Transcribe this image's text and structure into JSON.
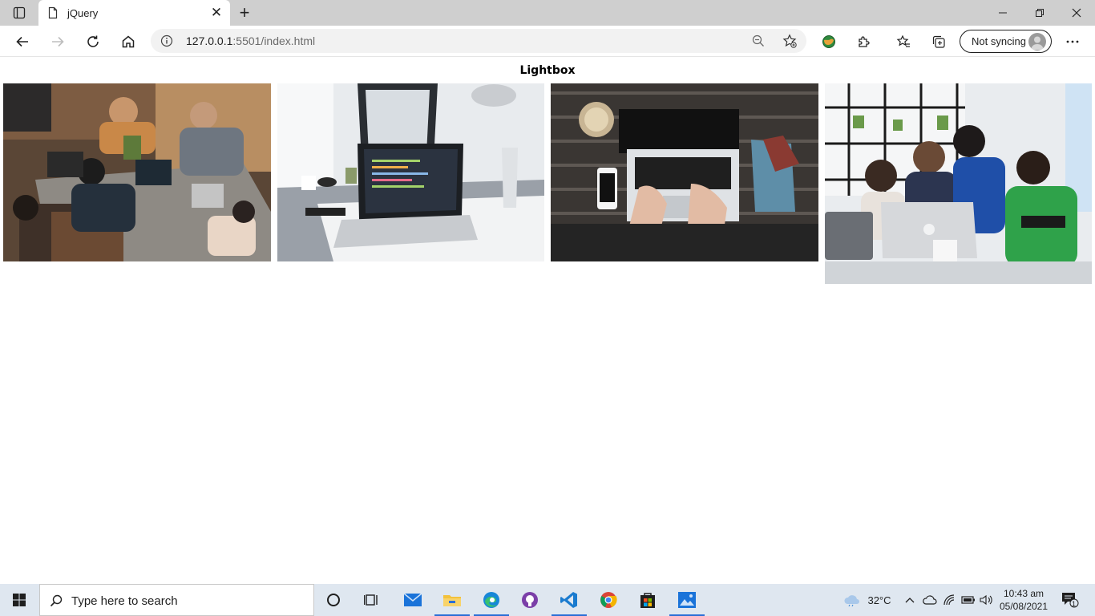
{
  "browser": {
    "tab": {
      "title": "jQuery"
    },
    "address": {
      "host": "127.0.0.1",
      "path": ":5501/index.html"
    },
    "sync": {
      "label": "Not syncing"
    }
  },
  "page": {
    "title": "Lightbox",
    "gallery": [
      {
        "name": "team-coding-photo"
      },
      {
        "name": "laptop-desk-photo"
      },
      {
        "name": "typing-laptop-photo"
      },
      {
        "name": "group-laptop-photo"
      }
    ]
  },
  "taskbar": {
    "search_placeholder": "Type here to search",
    "weather": "32°C",
    "time": "10:43 am",
    "date": "05/08/2021",
    "notification_count": "1"
  }
}
